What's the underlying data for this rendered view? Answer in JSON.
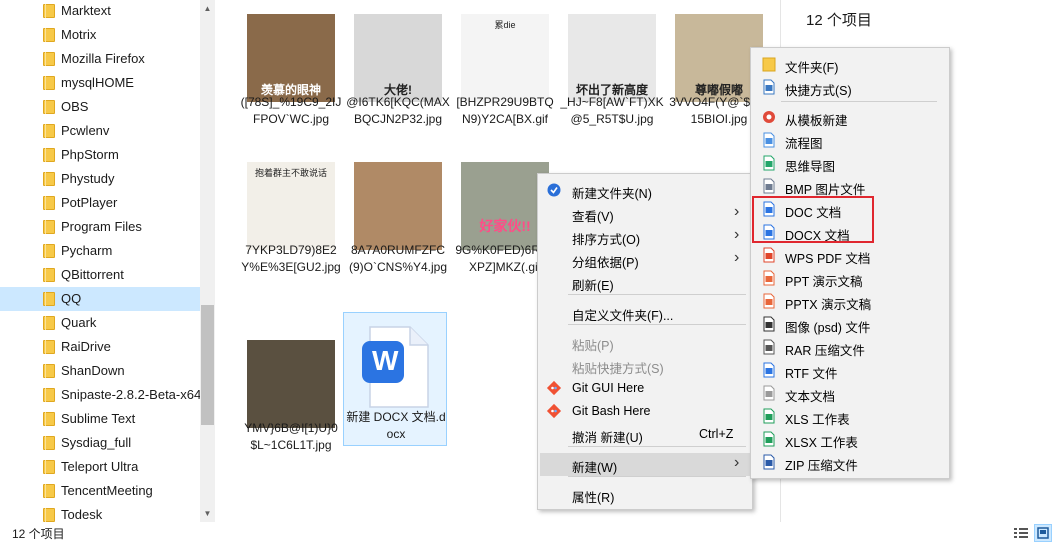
{
  "sidebar": {
    "folders": [
      "Marktext",
      "Motrix",
      "Mozilla Firefox",
      "mysqlHOME",
      "OBS",
      "Pcwlenv",
      "PhpStorm",
      "Phystudy",
      "PotPlayer",
      "Program Files",
      "Pycharm",
      "QBittorrent",
      "QQ",
      "Quark",
      "RaiDrive",
      "ShanDown",
      "Snipaste-2.8.2-Beta-x64",
      "Sublime Text",
      "Sysdiag_full",
      "Teleport Ultra",
      "TencentMeeting",
      "Todesk"
    ],
    "selected": "QQ"
  },
  "files": [
    {
      "name": "([78S]_%19C9_2IJFPOV`WC.jpg",
      "caption": "羡慕的眼神",
      "thumb_color": "#8a6a4a"
    },
    {
      "name": "@I6TK6[KQC(MAXBQCJN2P32.jpg",
      "caption": "大佬!",
      "thumb_color": "#d8d8d8"
    },
    {
      "name": "[BHZPR29U9BTQN9)Y2CA[BX.gif",
      "caption": "累die",
      "thumb_color": "#f4f4f4"
    },
    {
      "name": "_HJ~F8[AW`FT)XK@5_R5T$U.jpg",
      "caption": "坏出了新高度",
      "thumb_color": "#e8e8e8"
    },
    {
      "name": "3VVO4F(Y@`$[1R15BIOI.jpg",
      "caption": "尊嘟假嘟",
      "thumb_color": "#c8b89a"
    },
    {
      "name": "7YKP3LD79)8E2Y%E%3E[GU2.jpg",
      "caption": "抱着群主不敢说话",
      "thumb_color": "#f2efe8"
    },
    {
      "name": "8A7A0RUMFZFC(9)O`CNS%Y4.jpg",
      "caption": "",
      "thumb_color": "#b08a66"
    },
    {
      "name": "9G%K0FED)6RP9XPZ]MKZ(.gif",
      "caption": "好家伙!!",
      "thumb_color": "#9aa090"
    },
    {
      "name": "YMV}6B@I[1)U}0$L~1C6L1T.jpg",
      "caption": "",
      "thumb_color": "#5a5040"
    },
    {
      "name": "新建 DOCX 文档.docx",
      "caption": "W",
      "thumb_color": "#ffffff"
    }
  ],
  "info_panel": {
    "count": "12 个项目"
  },
  "status_bar": {
    "count": "12 个项目"
  },
  "context_menu": {
    "items": [
      {
        "label": "新建文件夹(N)",
        "icon": "shield-icon"
      },
      {
        "label": "查看(V)",
        "submenu": true
      },
      {
        "label": "排序方式(O)",
        "submenu": true
      },
      {
        "label": "分组依据(P)",
        "submenu": true
      },
      {
        "label": "刷新(E)"
      },
      {
        "label": "自定义文件夹(F)..."
      },
      {
        "label": "粘贴(P)",
        "disabled": true
      },
      {
        "label": "粘贴快捷方式(S)",
        "disabled": true
      },
      {
        "label": "Git GUI Here",
        "icon": "git-icon"
      },
      {
        "label": "Git Bash Here",
        "icon": "git-icon"
      },
      {
        "label": "撤消 新建(U)",
        "accelerator": "Ctrl+Z"
      },
      {
        "label": "新建(W)",
        "submenu": true
      },
      {
        "label": "属性(R)"
      }
    ]
  },
  "new_submenu": {
    "items": [
      {
        "label": "文件夹(F)",
        "icon": "folder-icon"
      },
      {
        "label": "快捷方式(S)",
        "icon": "shortcut-icon"
      },
      {
        "label": "从模板新建",
        "icon": "template-icon"
      },
      {
        "label": "流程图",
        "icon": "flowchart-icon"
      },
      {
        "label": "思维导图",
        "icon": "mindmap-icon"
      },
      {
        "label": "BMP 图片文件",
        "icon": "bmp-icon"
      },
      {
        "label": "DOC 文档",
        "icon": "doc-icon"
      },
      {
        "label": "DOCX 文档",
        "icon": "docx-icon"
      },
      {
        "label": "WPS PDF 文档",
        "icon": "pdf-icon"
      },
      {
        "label": "PPT 演示文稿",
        "icon": "ppt-icon"
      },
      {
        "label": "PPTX 演示文稿",
        "icon": "pptx-icon"
      },
      {
        "label": "图像 (psd) 文件",
        "icon": "psd-icon"
      },
      {
        "label": "RAR 压缩文件",
        "icon": "rar-icon"
      },
      {
        "label": "RTF 文件",
        "icon": "rtf-icon"
      },
      {
        "label": "文本文档",
        "icon": "txt-icon"
      },
      {
        "label": "XLS 工作表",
        "icon": "xls-icon"
      },
      {
        "label": "XLSX 工作表",
        "icon": "xlsx-icon"
      },
      {
        "label": "ZIP 压缩文件",
        "icon": "zip-icon"
      }
    ]
  },
  "colors": {
    "selection": "#cce8ff",
    "highlight_border": "#e0272f",
    "menu_bg": "#f2f2f2",
    "wps_blue": "#2b74e2"
  }
}
